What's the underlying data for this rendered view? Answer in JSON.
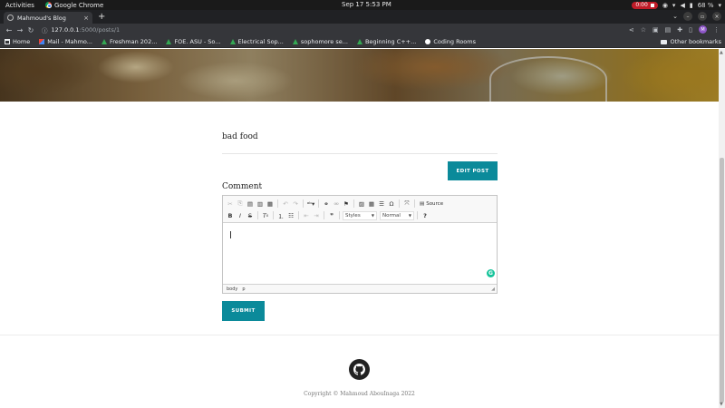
{
  "os_bar": {
    "activities": "Activities",
    "app_name": "Google Chrome",
    "clock": "Sep 17  5:53 PM",
    "recording": "0:00",
    "battery": "68 %"
  },
  "browser": {
    "tab_title": "Mahmoud's Blog",
    "tab_close": "×",
    "new_tab": "+",
    "url_host": "127.0.0.1",
    "url_path": ":5000/posts/1",
    "bookmarks": [
      {
        "label": "Home",
        "icon": "home-icon"
      },
      {
        "label": "Mail - Mahmo...",
        "icon": "gmail-icon"
      },
      {
        "label": "Freshman 202...",
        "icon": "drive-icon"
      },
      {
        "label": "FOE. ASU - So...",
        "icon": "drive-icon"
      },
      {
        "label": "Electrical Sop...",
        "icon": "drive-icon"
      },
      {
        "label": "sophomore se...",
        "icon": "drive-icon"
      },
      {
        "label": "Beginning C++...",
        "icon": "drive-icon"
      },
      {
        "label": "Coding Rooms",
        "icon": "coding-rooms-icon"
      }
    ],
    "other_bookmarks": "Other bookmarks",
    "profile_initial": "M"
  },
  "post": {
    "body": "bad food",
    "edit_button": "EDIT POST"
  },
  "comment": {
    "label": "Comment",
    "editor": {
      "source_label": "Source",
      "styles_placeholder": "Styles",
      "format_value": "Normal",
      "path_body": "body",
      "path_p": "p",
      "grammarly": "G"
    },
    "submit_button": "SUBMIT"
  },
  "footer": {
    "copyright": "Copyright © Mahmoud AbouInaga 2022"
  },
  "colors": {
    "accent": "#0b8a9a",
    "recording": "#c01c28"
  }
}
